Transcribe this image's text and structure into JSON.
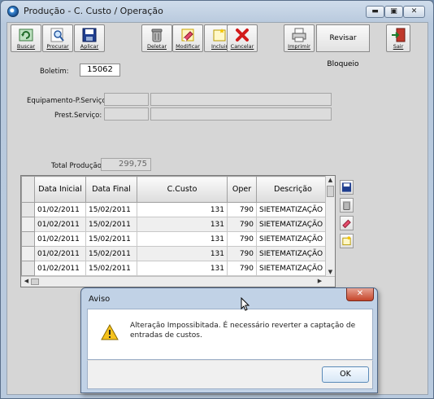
{
  "window": {
    "title": "Produção - C. Custo / Operação",
    "minimize": "▬",
    "maximize": "▣",
    "close": "✕"
  },
  "toolbar": {
    "buscar": "Buscar",
    "procurar": "Procurar",
    "aplicar": "Aplicar",
    "deletar": "Deletar",
    "modificar": "Modificar",
    "incluir": "Incluir",
    "cancelar": "Cancelar",
    "imprimir": "Imprimir",
    "revisar": "Revisar Bloqueio",
    "sair": "Sair"
  },
  "form": {
    "boletim_label": "Boletim:",
    "boletim_value": "15062",
    "equipamento_label": "Equipamento-P.Serviço:",
    "prest_label": "Prest.Serviço:",
    "total_label": "Total Produção:",
    "total_value": "299,75"
  },
  "grid": {
    "headers": [
      "Data Inicial",
      "Data Final",
      "C.Custo",
      "Oper",
      "Descrição"
    ],
    "rows": [
      [
        "01/02/2011",
        "15/02/2011",
        "131",
        "790",
        "SIETEMATIZAÇÃO"
      ],
      [
        "01/02/2011",
        "15/02/2011",
        "131",
        "790",
        "SIETEMATIZAÇÃO"
      ],
      [
        "01/02/2011",
        "15/02/2011",
        "131",
        "790",
        "SIETEMATIZAÇÃO"
      ],
      [
        "01/02/2011",
        "15/02/2011",
        "131",
        "790",
        "SIETEMATIZAÇÃO"
      ],
      [
        "01/02/2011",
        "15/02/2011",
        "131",
        "790",
        "SIETEMATIZAÇÃO"
      ]
    ]
  },
  "dialog": {
    "title": "Aviso",
    "close": "✕",
    "message": "Alteração Impossibitada. É necessário reverter a captação de entradas de custos.",
    "ok": "OK"
  },
  "colors": {
    "window_frame": "#b9cade",
    "client_bg": "#d6d6d6",
    "dialog_close": "#c5452a"
  }
}
